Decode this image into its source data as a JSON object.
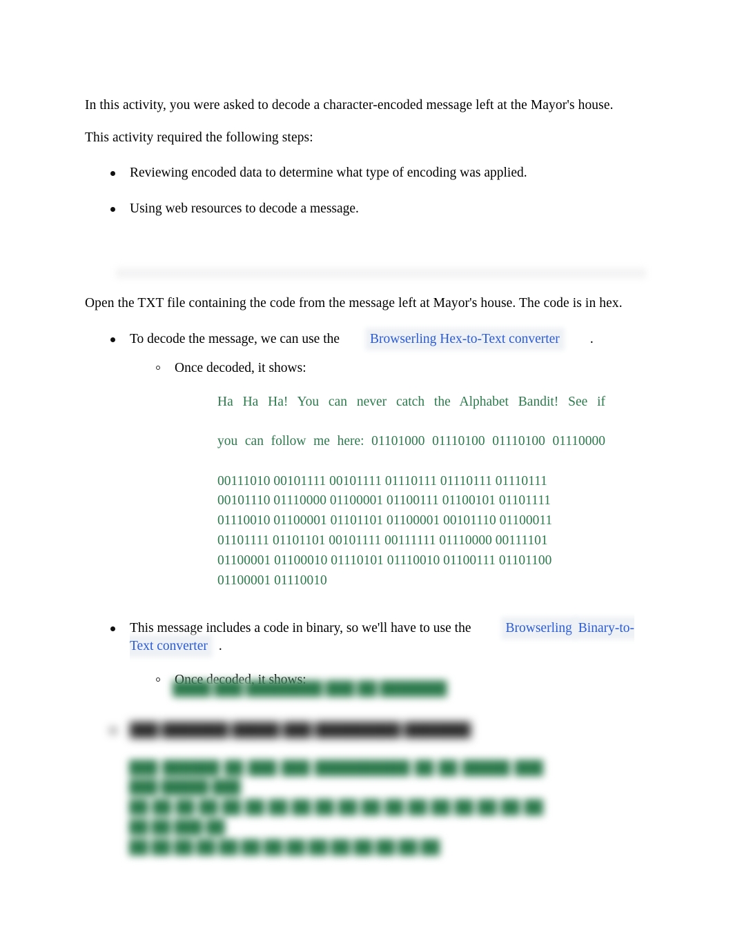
{
  "document": {
    "intro_paragraph": "In this activity, you were asked to decode a character-encoded message left at the Mayor's house.",
    "steps_heading": "This activity required the following steps:",
    "steps": [
      "Reviewing encoded data to determine what type of encoding was applied.",
      "Using web resources to decode a message."
    ],
    "open_file_paragraph": "Open the TXT file containing the code from the message left at Mayor's house. The code is in hex.",
    "hex_bullet": {
      "text_before_link": "To decode the message, we can use the",
      "link_label": "Browserling Hex-to-Text converter",
      "trailing_punctuation": ".",
      "sub_bullet": "Once decoded, it shows:"
    },
    "decoded_hex_message": {
      "lines": [
        " Ha Ha Ha! You can never catch the Alphabet Bandit! See if",
        "you can follow me here: 01101000 01110100 01110100 01110000",
        "00111010 00101111 00101111 01110111 01110111 01110111",
        "00101110 01110000 01100001 01100111 01100101 01101111",
        "01110010 01100001 01101101 01100001 00101110 01100011",
        "01101111 01101101 00101111 00111111 01110000 00111101",
        "01100001 01100010 01110101 01110010 01100111 01101100",
        "01100001 01110010"
      ],
      "full_text": "Ha Ha Ha! You can never catch the Alphabet Bandit! See if you can follow me here: 01101000 01110100 01110100 01110000 00111010 00101111 00101111 01110111 01110111 01110111 00101110 01110000 01100001 01100111 01100101 01101111 01110010 01100001 01101101 01100001 00101110 01100011 01101111 01101101 00101111 00111111 01110000 00111101 01100001 01100010 01110101 01110010 01100111 01101100 01100001 01110010"
    },
    "binary_bullet": {
      "text_before_link": "This message includes a code in binary, so we'll have to use the",
      "link_label_part1": "Browserling",
      "link_label_part2": "Binary-to-Text converter",
      "trailing_punctuation": ".",
      "sub_bullet": "Once decoded, it shows:"
    },
    "redacted": {
      "note": "redacted",
      "decoded_binary_placeholder": "████ ███ ████████ ███ ██ ███████",
      "bullet_placeholder": "███ ███████ █████ ███ █████████ ███████",
      "final_lines": [
        "███ ██████ ██ ███ ███ ██████████ ██ ██ █████ ███ ███ █████ ███",
        "██ ██ ██ ██ ██ ██ ██ ██ ██ ██ ██ ██ ██ ██ ██ ██ ██ ██ ██ ██ ███ ██",
        "██ ██ ██ ██ ██ ██ ██ ██ ██ ██ ██ ██ ██ ██"
      ]
    }
  },
  "colors": {
    "page_background": "#ffffff",
    "body_text": "#000000",
    "link": "#2a5bd7",
    "link_highlight": "#eef1f5",
    "decoded_green": "#2d7a4d",
    "green_highlight": "#edf5ef"
  }
}
